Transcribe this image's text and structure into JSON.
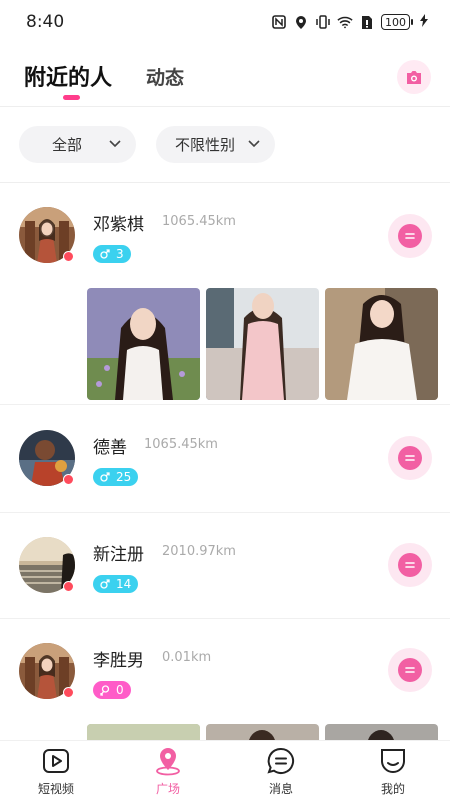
{
  "status_bar": {
    "time": "8:40",
    "battery": "100"
  },
  "tabs": {
    "nearby": "附近的人",
    "dynamic": "动态"
  },
  "filters": {
    "all": "全部",
    "gender": "不限性别"
  },
  "users": [
    {
      "name": "邓紫棋",
      "distance": "1065.45km",
      "badge": "3",
      "gender": "male"
    },
    {
      "name": "德善",
      "distance": "1065.45km",
      "badge": "25",
      "gender": "male"
    },
    {
      "name": "新注册",
      "distance": "2010.97km",
      "badge": "14",
      "gender": "male"
    },
    {
      "name": "李胜男",
      "distance": "0.01km",
      "badge": "0",
      "gender": "female"
    }
  ],
  "bottom_nav": [
    {
      "label": "短视频",
      "icon": "video-icon"
    },
    {
      "label": "广场",
      "icon": "location-pin-icon",
      "active": true
    },
    {
      "label": "消息",
      "icon": "message-icon"
    },
    {
      "label": "我的",
      "icon": "profile-icon"
    }
  ],
  "colors": {
    "accent": "#f25fa3",
    "male_badge": "#3bd1ef",
    "female_badge": "#ff5cc8",
    "online_dot": "#ff4b5c"
  }
}
